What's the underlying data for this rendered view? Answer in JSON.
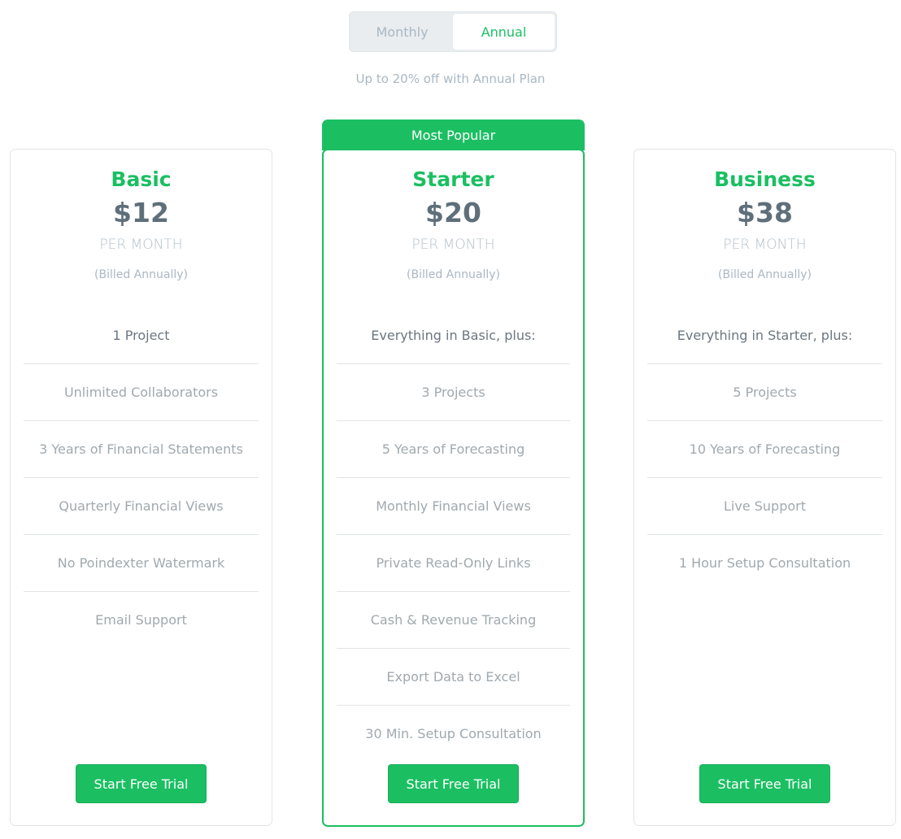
{
  "billing_toggle": {
    "options": [
      "Monthly",
      "Annual"
    ],
    "selected": "Annual"
  },
  "discount_note": "Up to 20% off with Annual Plan",
  "colors": {
    "accent": "#1bbf62",
    "price_text": "#5f6f7a",
    "muted_text": "#a9b8c4"
  },
  "plans": [
    {
      "name": "Basic",
      "price": "$12",
      "period": "PER MONTH",
      "billed": "(Billed Annually)",
      "lead": "1 Project",
      "features": [
        "Unlimited Collaborators",
        "3 Years of Financial Statements",
        "Quarterly Financial Views",
        "No Poindexter Watermark",
        "Email Support"
      ],
      "cta": "Start Free Trial"
    },
    {
      "name": "Starter",
      "badge": "Most Popular",
      "price": "$20",
      "period": "PER MONTH",
      "billed": "(Billed Annually)",
      "lead": "Everything in Basic, plus:",
      "features": [
        "3 Projects",
        "5 Years of Forecasting",
        "Monthly Financial Views",
        "Private Read-Only Links",
        "Cash & Revenue Tracking",
        "Export Data to Excel",
        "30 Min. Setup Consultation"
      ],
      "cta": "Start Free Trial"
    },
    {
      "name": "Business",
      "price": "$38",
      "period": "PER MONTH",
      "billed": "(Billed Annually)",
      "lead": "Everything in Starter, plus:",
      "features": [
        "5 Projects",
        "10 Years of Forecasting",
        "Live Support",
        "1 Hour Setup Consultation"
      ],
      "cta": "Start Free Trial"
    }
  ]
}
